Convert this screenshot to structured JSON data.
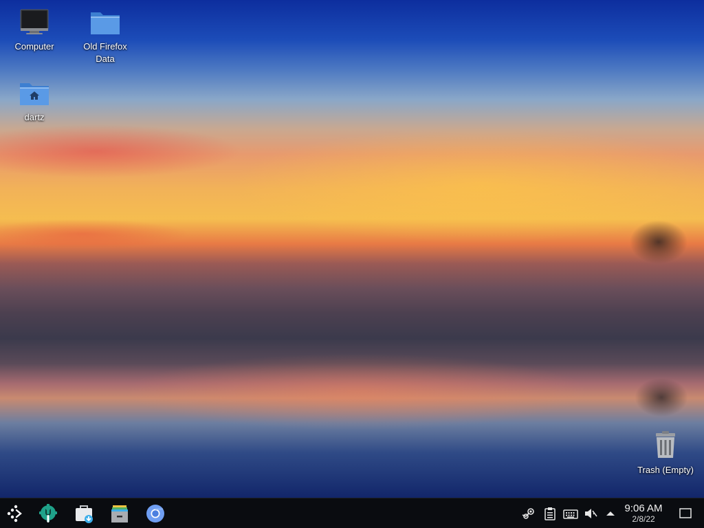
{
  "desktop": {
    "icons": [
      {
        "label": "Computer",
        "icon": "computer-monitor-icon"
      },
      {
        "label": "Old Firefox\nData",
        "icon": "folder-icon"
      },
      {
        "label": "dartz",
        "icon": "home-folder-icon"
      },
      {
        "label": "Trash (Empty)",
        "icon": "trash-empty-icon"
      }
    ]
  },
  "taskbar": {
    "launcher_icon": "application-launcher-icon",
    "pinned": [
      {
        "name": "system-settings",
        "icon": "wrench-gear-icon"
      },
      {
        "name": "discover",
        "icon": "software-store-icon"
      },
      {
        "name": "file-manager",
        "icon": "file-cabinet-icon"
      },
      {
        "name": "web-browser",
        "icon": "chromium-browser-icon"
      }
    ],
    "tray": [
      {
        "name": "steam",
        "icon": "steam-icon"
      },
      {
        "name": "clipboard",
        "icon": "clipboard-icon"
      },
      {
        "name": "virtual-keyboard",
        "icon": "keyboard-icon"
      },
      {
        "name": "volume",
        "icon": "volume-muted-icon"
      },
      {
        "name": "show-hidden",
        "icon": "arrow-up-icon"
      }
    ],
    "clock": {
      "time": "9:06 AM",
      "date": "2/8/22"
    },
    "show_desktop_icon": "show-desktop-icon"
  },
  "colors": {
    "taskbar_bg": "#0a0c10",
    "folder_blue": "#5a9ae6",
    "text": "#ffffff"
  }
}
